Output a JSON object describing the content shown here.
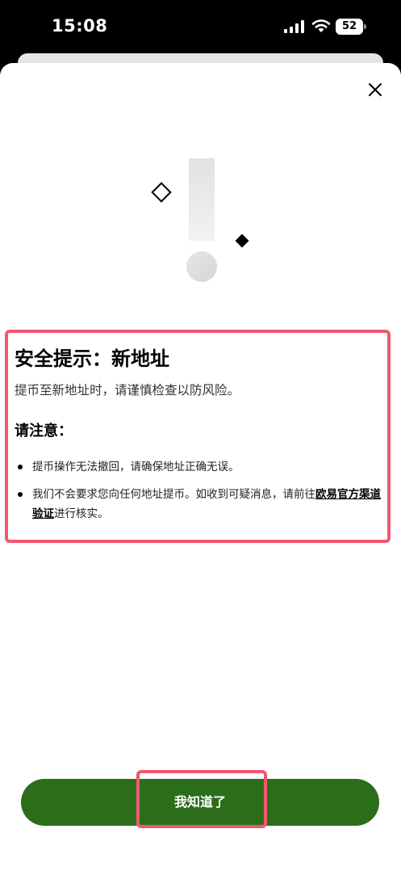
{
  "status_bar": {
    "time": "15:08",
    "battery_level": "52",
    "icons": [
      "signal-icon",
      "wifi-icon",
      "battery-icon"
    ]
  },
  "dialog": {
    "close_icon": "close-icon",
    "illustration_icon": "exclamation-warning-icon",
    "title": "安全提示：新地址",
    "subtitle": "提币至新地址时，请谨慎检查以防风险。",
    "attention_heading": "请注意：",
    "bullets": {
      "item1": "提币操作无法撤回，请确保地址正确无误。",
      "item2_prefix": "我们不会要求您向任何地址提币。如收到可疑消息，请前往",
      "item2_link": "欧易官方渠道验证",
      "item2_suffix": "进行核实。"
    },
    "confirm_label": "我知道了"
  },
  "colors": {
    "primary_button": "#2c6d1a",
    "highlight_border": "#f4566e",
    "background": "#ffffff",
    "status_bar": "#000000"
  }
}
